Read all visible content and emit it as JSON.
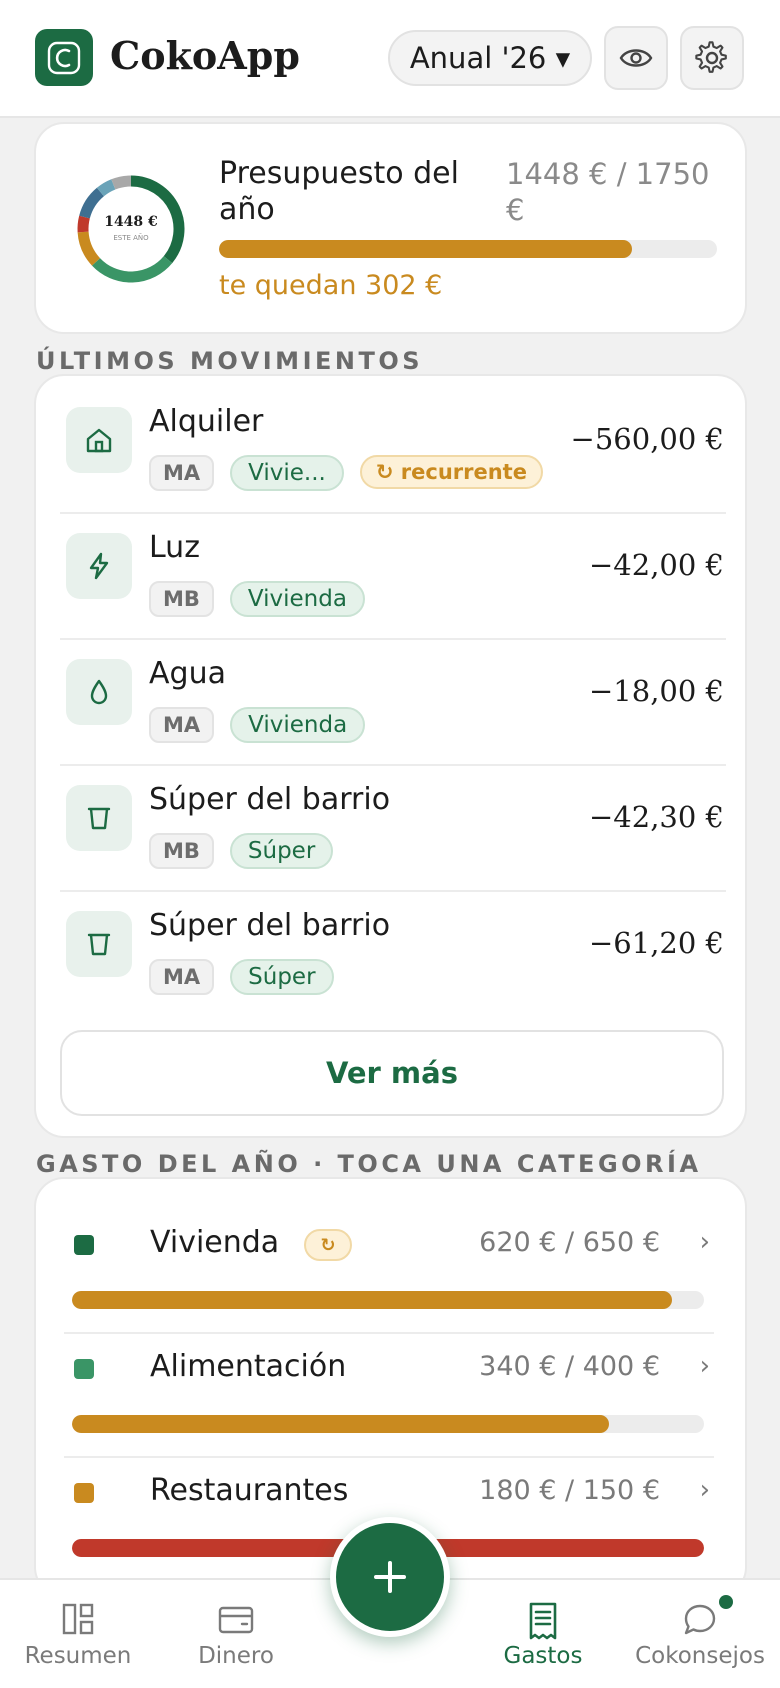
{
  "header": {
    "app_name": "CokoApp",
    "period_label": "Anual '26 ▾",
    "visibility_icon": "eye-icon",
    "settings_icon": "gear-icon"
  },
  "budget": {
    "donut_value": "1448 €",
    "donut_caption": "ESTE AÑO",
    "title": "Presupuesto del año",
    "amount": "1448 € / 1750 €",
    "progress": 0.83,
    "remaining": "te quedan 302 €"
  },
  "movements": {
    "section_title": "ÚLTIMOS MOVIMIENTOS",
    "items": [
      {
        "name": "Alquiler",
        "user": "MA",
        "category": "Vivie...",
        "recurrent": "↻ recurrente",
        "amount": "−560,00 €",
        "icon": "home-icon"
      },
      {
        "name": "Luz",
        "user": "MB",
        "category": "Vivienda",
        "recurrent": "",
        "amount": "−42,00 €",
        "icon": "lightning-icon"
      },
      {
        "name": "Agua",
        "user": "MA",
        "category": "Vivienda",
        "recurrent": "",
        "amount": "−18,00 €",
        "icon": "water-drop-icon"
      },
      {
        "name": "Súper del barrio",
        "user": "MB",
        "category": "Súper",
        "recurrent": "",
        "amount": "−42,30 €",
        "icon": "basket-icon"
      },
      {
        "name": "Súper del barrio",
        "user": "MA",
        "category": "Súper",
        "recurrent": "",
        "amount": "−61,20 €",
        "icon": "basket-icon"
      }
    ],
    "see_more": "Ver más"
  },
  "categories": {
    "section_title": "GASTO DEL AÑO · TOCA UNA CATEGORÍA",
    "items": [
      {
        "name": "Vivienda",
        "recurrent": "↻",
        "amount": "620 € / 650 €",
        "chevron": "›",
        "progress": 0.95,
        "dot_color": "#1c6b43",
        "bar_color": "#c98a1f"
      },
      {
        "name": "Alimentación",
        "recurrent": "",
        "amount": "340 € / 400 €",
        "chevron": "›",
        "progress": 0.85,
        "dot_color": "#3a9566",
        "bar_color": "#c98a1f"
      },
      {
        "name": "Restaurantes",
        "recurrent": "",
        "amount": "180 € / 150 €",
        "chevron": "›",
        "progress": 1.0,
        "dot_color": "#c98a1f",
        "bar_color": "#c0392b"
      }
    ]
  },
  "nav": {
    "items": [
      {
        "label": "Resumen",
        "icon": "dashboard-icon",
        "active": false
      },
      {
        "label": "Dinero",
        "icon": "wallet-icon",
        "active": false
      },
      {
        "label": "Gastos",
        "icon": "receipt-icon",
        "active": true
      },
      {
        "label": "Cokonsejos",
        "icon": "chat-bubble-icon",
        "active": false
      }
    ],
    "add_icon": "plus-icon"
  },
  "colors": {
    "brand_green": "#1c6b43",
    "accent_gold": "#c98a1f",
    "danger_red": "#c0392b"
  }
}
